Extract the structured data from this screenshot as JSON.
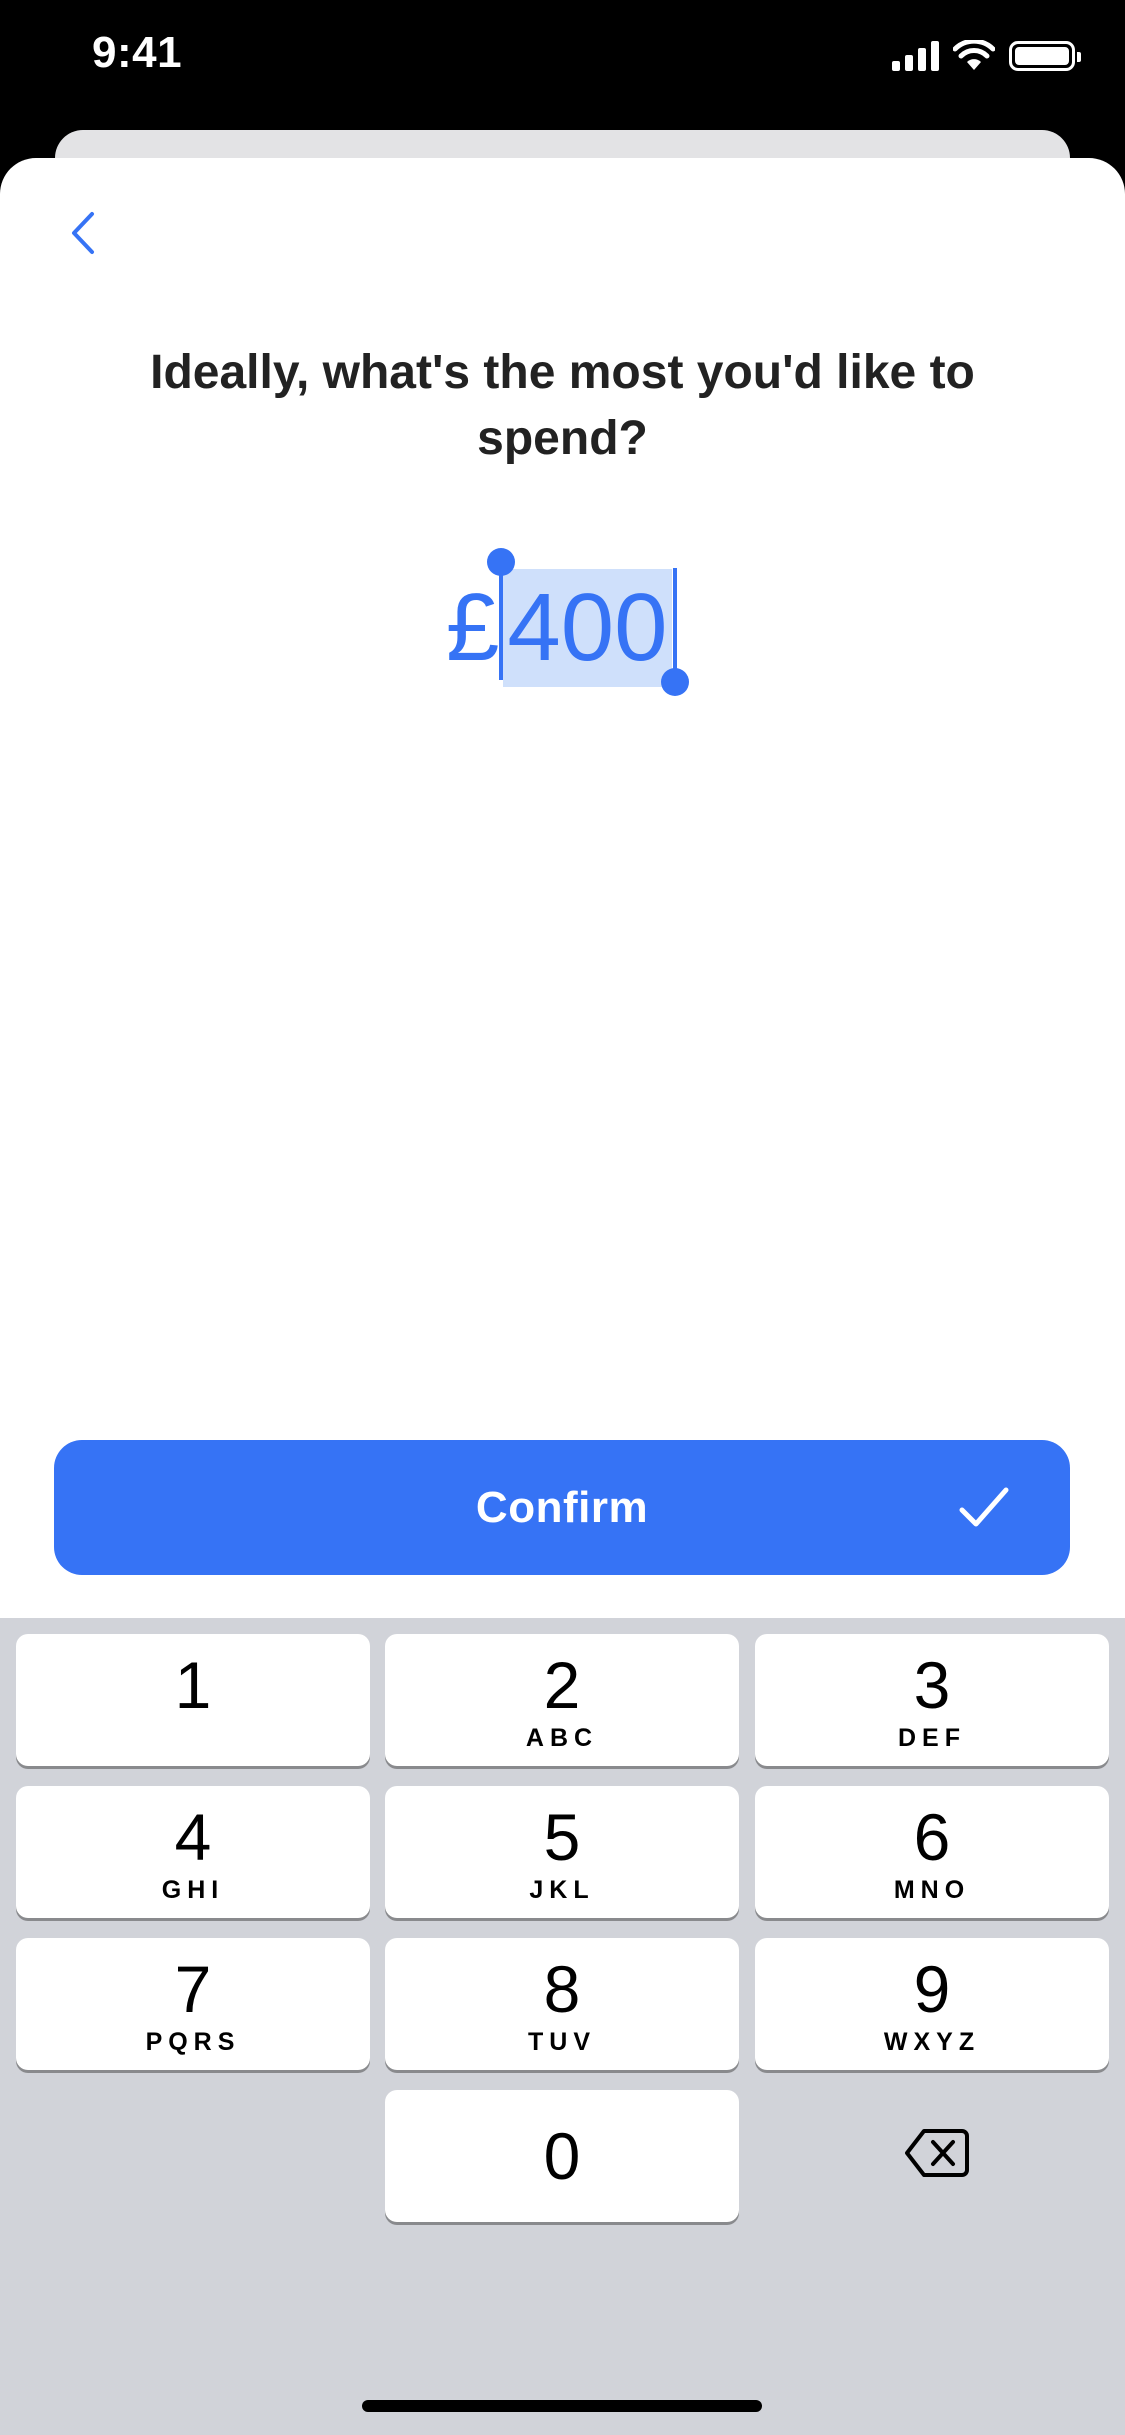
{
  "status_bar": {
    "time": "9:41"
  },
  "header": {
    "back_icon": "chevron-left-icon"
  },
  "main": {
    "question": "Ideally, what's the most you'd like to spend?",
    "amount": {
      "currency": "£",
      "value": "400",
      "selected": true
    }
  },
  "confirm": {
    "label": "Confirm",
    "icon": "check-icon"
  },
  "keypad": {
    "keys": [
      {
        "digit": "1",
        "letters": ""
      },
      {
        "digit": "2",
        "letters": "ABC"
      },
      {
        "digit": "3",
        "letters": "DEF"
      },
      {
        "digit": "4",
        "letters": "GHI"
      },
      {
        "digit": "5",
        "letters": "JKL"
      },
      {
        "digit": "6",
        "letters": "MNO"
      },
      {
        "digit": "7",
        "letters": "PQRS"
      },
      {
        "digit": "8",
        "letters": "TUV"
      },
      {
        "digit": "9",
        "letters": "WXYZ"
      },
      {
        "digit": "0",
        "letters": ""
      }
    ],
    "delete_icon": "backspace-icon"
  },
  "colors": {
    "accent": "#3673f5",
    "keyboard_bg": "#d1d3d9",
    "selection": "#cfe0fb"
  }
}
